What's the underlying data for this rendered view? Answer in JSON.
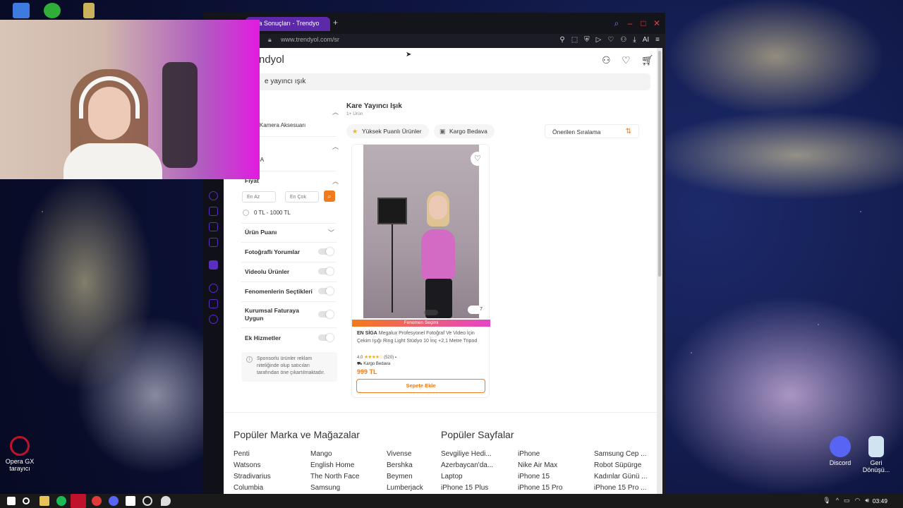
{
  "desktop": {
    "icons": [
      {
        "name": "Opera GX tarayıcı",
        "color": "#c1122b"
      },
      {
        "name": "Discord",
        "color": "#5865f2"
      },
      {
        "name": "Geri Dönüşü...",
        "color": "#cfe3f0"
      }
    ]
  },
  "browser": {
    "tab_title": "ama Sonuçları - Trendyo",
    "url": "www.trendyol.com/sr",
    "ai_label": "AI"
  },
  "page": {
    "logo": "ndyol",
    "search_value": "e yayıncı ışık",
    "filters": {
      "category_head": "gori",
      "category_item": "oto & Kamera Aksesuarı",
      "brand_head": "a",
      "brand_item": "N SİGA",
      "price_head": "Fiyat",
      "price_min_placeholder": "En Az",
      "price_max_placeholder": "En Çok",
      "price_range": "0 TL - 1000 TL",
      "rating_head": "Ürün Puanı",
      "toggles": [
        "Fotoğraflı Yorumlar",
        "Videolu Ürünler",
        "Fenomenlerin Seçtikleri",
        "Kurumsal Faturaya Uygun",
        "Ek Hizmetler"
      ],
      "info": "Sponsorlu ürünler reklam niteliğinde olup satıcıları tarafından öne çıkartılmaktadır."
    },
    "results": {
      "title": "Kare Yayıncı Işık",
      "count": "1+ Ürün",
      "chip1": "Yüksek Puanlı Ürünler",
      "chip2": "Kargo Bedava",
      "sort": "Önerilen Sıralama"
    },
    "product": {
      "image_count": "7",
      "badge": "Fenomen Seçimi",
      "brand": "EN SİGA",
      "title": "Megalux Profesyonel Fotoğraf Ve Video İçin Çekim Işığı Ring Light Stüdyo 10 İnç +2,1 Metre Tripod",
      "rating": "4.0",
      "stars": 4,
      "reviews": "(520)",
      "cargo": "Kargo Bedava",
      "price": "999 TL",
      "cta": "Sepete Ekle"
    },
    "footer": {
      "brands_title": "Popüler Marka ve Mağazalar",
      "pages_title": "Popüler Sayfalar",
      "brands": [
        [
          "Penti",
          "Watsons",
          "Stradivarius",
          "Columbia"
        ],
        [
          "Mango",
          "English Home",
          "The North Face",
          "Samsung"
        ],
        [
          "Vivense",
          "Bershka",
          "Beymen",
          "Lumberjack"
        ]
      ],
      "pages": [
        [
          "Sevgiliye Hedi...",
          "Azerbaycan'da...",
          "Laptop",
          "iPhone 15 Plus"
        ],
        [
          "iPhone",
          "Nike Air Max",
          "iPhone 15",
          "iPhone 15 Pro"
        ],
        [
          "Samsung Cep ...",
          "Robot Süpürge",
          "Kadınlar Günü ...",
          "iPhone 15 Pro ..."
        ]
      ]
    }
  },
  "taskbar": {
    "clock": "03:49"
  },
  "colors": {
    "brand_orange": "#f27a1a",
    "opera_purple": "#5c2aa8"
  }
}
